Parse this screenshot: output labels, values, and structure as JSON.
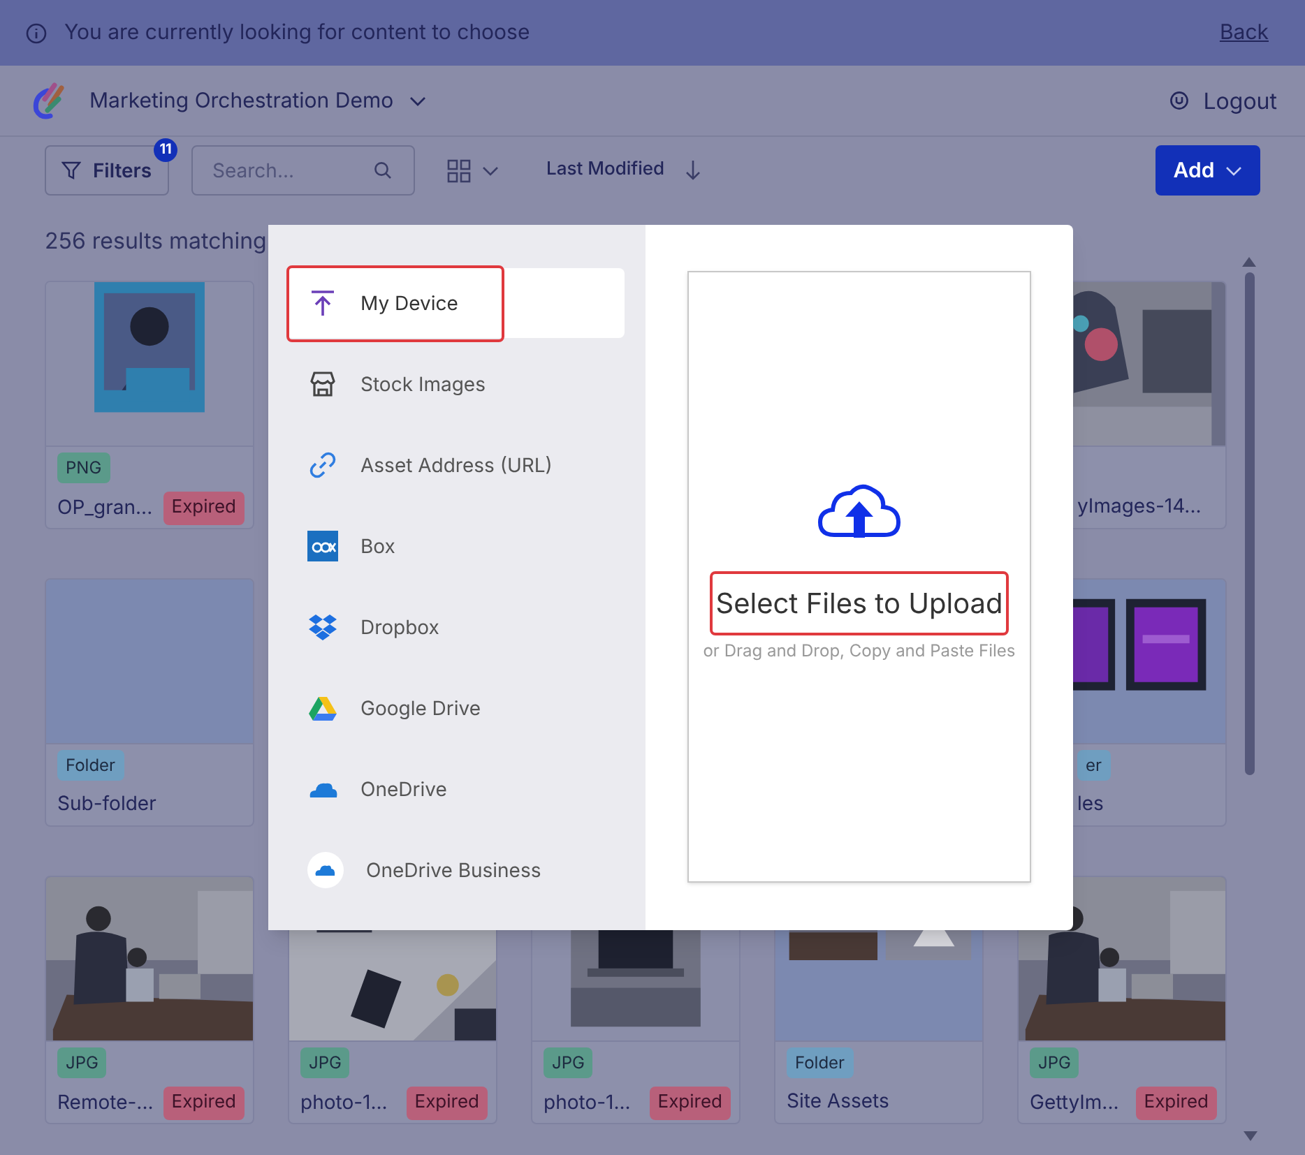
{
  "banner": {
    "message": "You are currently looking for content to choose",
    "link": "Back"
  },
  "header": {
    "workspace": "Marketing Orchestration Demo",
    "logout": "Logout"
  },
  "toolbar": {
    "filters": "Filters",
    "filter_count": "11",
    "search": {
      "placeholder": "Search..."
    },
    "sort": "Last Modified",
    "add": "Add"
  },
  "results": "256 results matching",
  "rows": [
    {
      "cards": [
        {
          "tag": "PNG",
          "color": "#5b9a8a",
          "name": "OP_gran...",
          "badge": "Expired"
        },
        {
          "name": "yImages-14..."
        }
      ]
    },
    {
      "cards": [
        {
          "tag": "Folder",
          "color": "#6f9ec0",
          "name": "Sub-folder"
        },
        {
          "tag": "er",
          "color": "#6f9ec0",
          "name": "les"
        }
      ]
    },
    {
      "cards": [
        {
          "tag": "JPG",
          "color": "#5b9a8a",
          "name": "Remote-...",
          "badge": "Expired"
        },
        {
          "tag": "JPG",
          "color": "#5b9a8a",
          "name": "photo-1...",
          "badge": "Expired"
        },
        {
          "tag": "JPG",
          "color": "#5b9a8a",
          "name": "photo-1...",
          "badge": "Expired"
        },
        {
          "tag": "Folder",
          "color": "#6f9ec0",
          "name": "Site Assets"
        },
        {
          "tag": "JPG",
          "color": "#5b9a8a",
          "name": "GettyIm...",
          "badge": "Expired"
        }
      ]
    }
  ],
  "dialog": {
    "sources": [
      {
        "kind": "device",
        "label": "My Device",
        "selected": true,
        "highlighted": true
      },
      {
        "kind": "stock",
        "label": "Stock Images",
        "selected": false,
        "highlighted": false
      },
      {
        "kind": "url",
        "label": "Asset Address (URL)",
        "selected": false,
        "highlighted": false
      },
      {
        "kind": "box",
        "label": "Box",
        "selected": false,
        "highlighted": false
      },
      {
        "kind": "dropbox",
        "label": "Dropbox",
        "selected": false,
        "highlighted": false
      },
      {
        "kind": "gdrive",
        "label": "Google Drive",
        "selected": false,
        "highlighted": false
      },
      {
        "kind": "onedrive",
        "label": "OneDrive",
        "selected": false,
        "highlighted": false
      },
      {
        "kind": "onedrive_business",
        "label": "OneDrive Business",
        "selected": false,
        "highlighted": false
      }
    ],
    "upload": {
      "title": "Select Files to Upload",
      "title_highlighted": true,
      "hint": "or Drag and Drop, Copy and Paste Files"
    }
  }
}
